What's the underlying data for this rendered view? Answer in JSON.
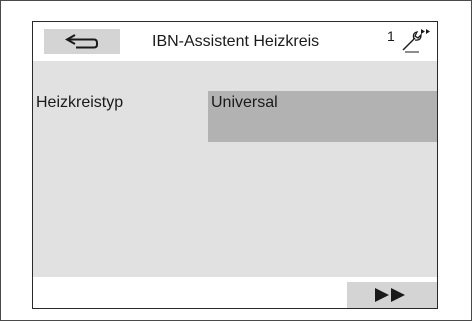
{
  "header": {
    "title": "IBN-Assistent Heizkreis",
    "page_number": "1",
    "back_icon": "back-arrow-icon",
    "service_icon": "wrench-icon"
  },
  "content": {
    "field_label": "Heizkreistyp",
    "field_value": "Universal"
  },
  "footer": {
    "next_icon": "fast-forward-icon"
  },
  "colors": {
    "button_bg": "#d4d4d4",
    "content_bg": "#e1e1e1",
    "selected_bg": "#b2b2b2"
  }
}
